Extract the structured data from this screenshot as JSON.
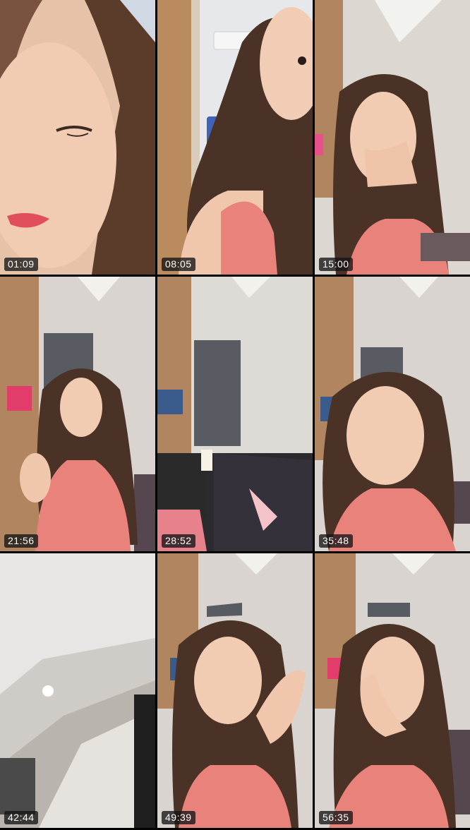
{
  "grid": {
    "tiles": [
      {
        "time": "01:09",
        "scene": "closeup"
      },
      {
        "time": "08:05",
        "scene": "side"
      },
      {
        "time": "15:00",
        "scene": "room-hand"
      },
      {
        "time": "21:56",
        "scene": "room-far"
      },
      {
        "time": "28:52",
        "scene": "room-empty"
      },
      {
        "time": "35:48",
        "scene": "room-near"
      },
      {
        "time": "42:44",
        "scene": "ceiling"
      },
      {
        "time": "49:39",
        "scene": "room-hand"
      },
      {
        "time": "56:35",
        "scene": "room-hand"
      }
    ]
  },
  "colors": {
    "wall": "#d9d4cf",
    "cabinet": "#b0855f",
    "curtain": "#595b63",
    "top": "#e8827a",
    "hair": "#4a3226",
    "skin": "#f2cbb3"
  }
}
